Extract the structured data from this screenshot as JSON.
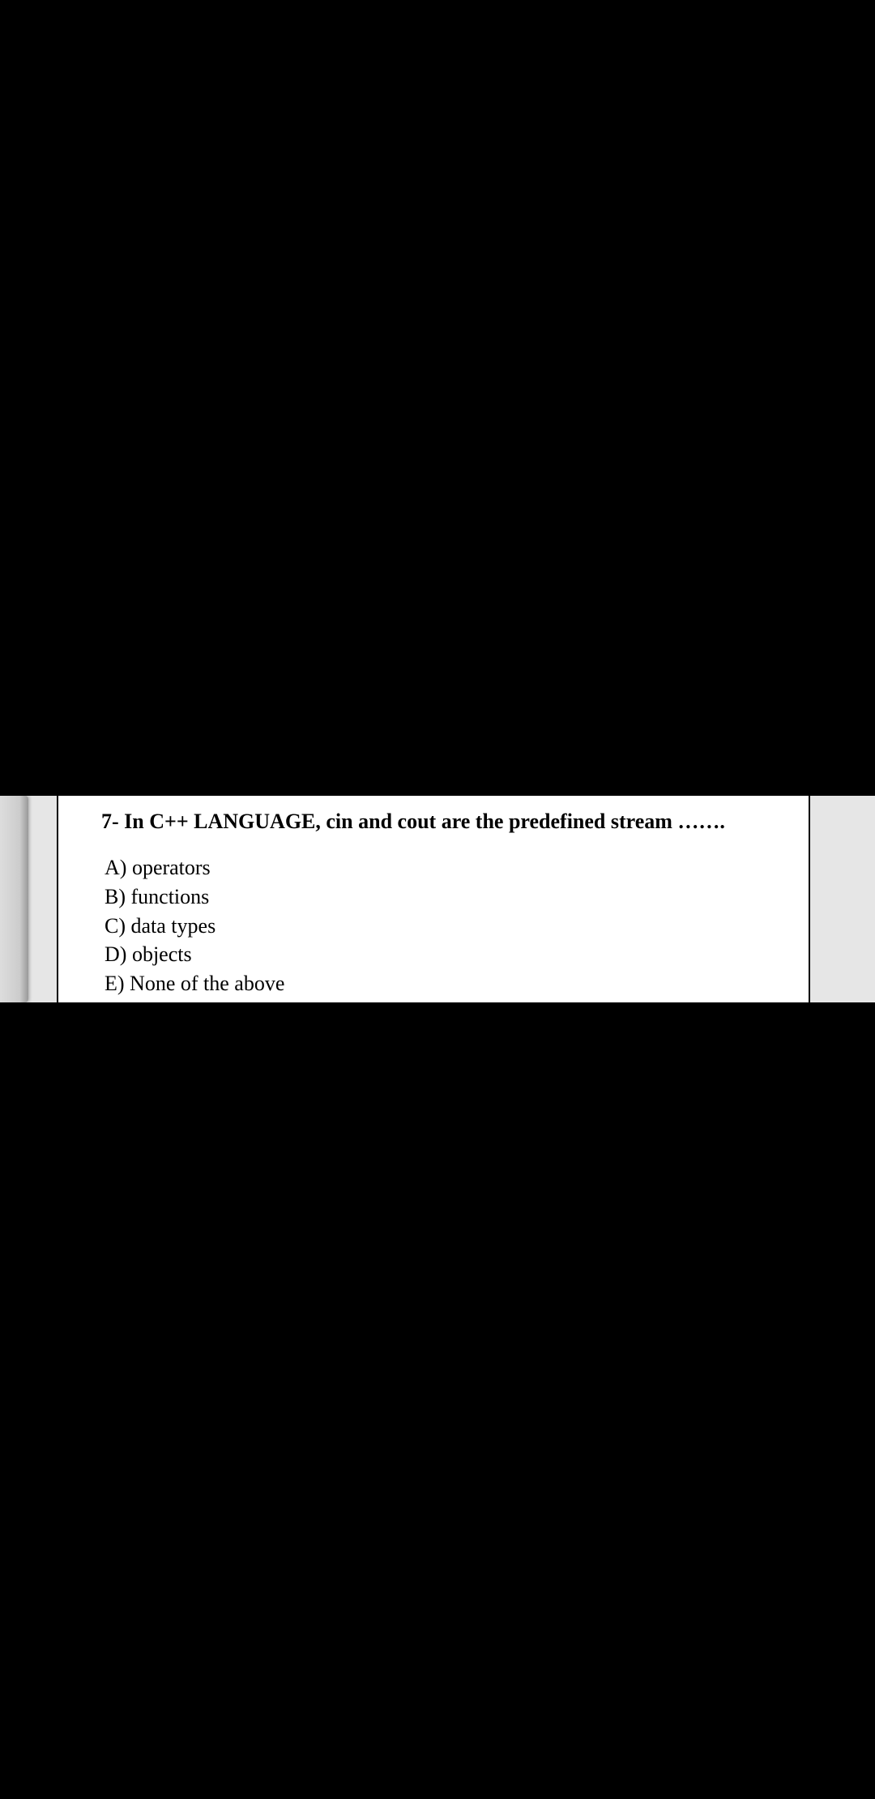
{
  "question": {
    "number": "7-",
    "text": "In C++ LANGUAGE, cin and cout are the predefined stream …….",
    "options": [
      {
        "letter": "A)",
        "text": "operators"
      },
      {
        "letter": "B)",
        "text": "functions"
      },
      {
        "letter": "C)",
        "text": "data types"
      },
      {
        "letter": "D)",
        "text": "objects"
      },
      {
        "letter": "E)",
        "text": "None of the above"
      }
    ]
  }
}
